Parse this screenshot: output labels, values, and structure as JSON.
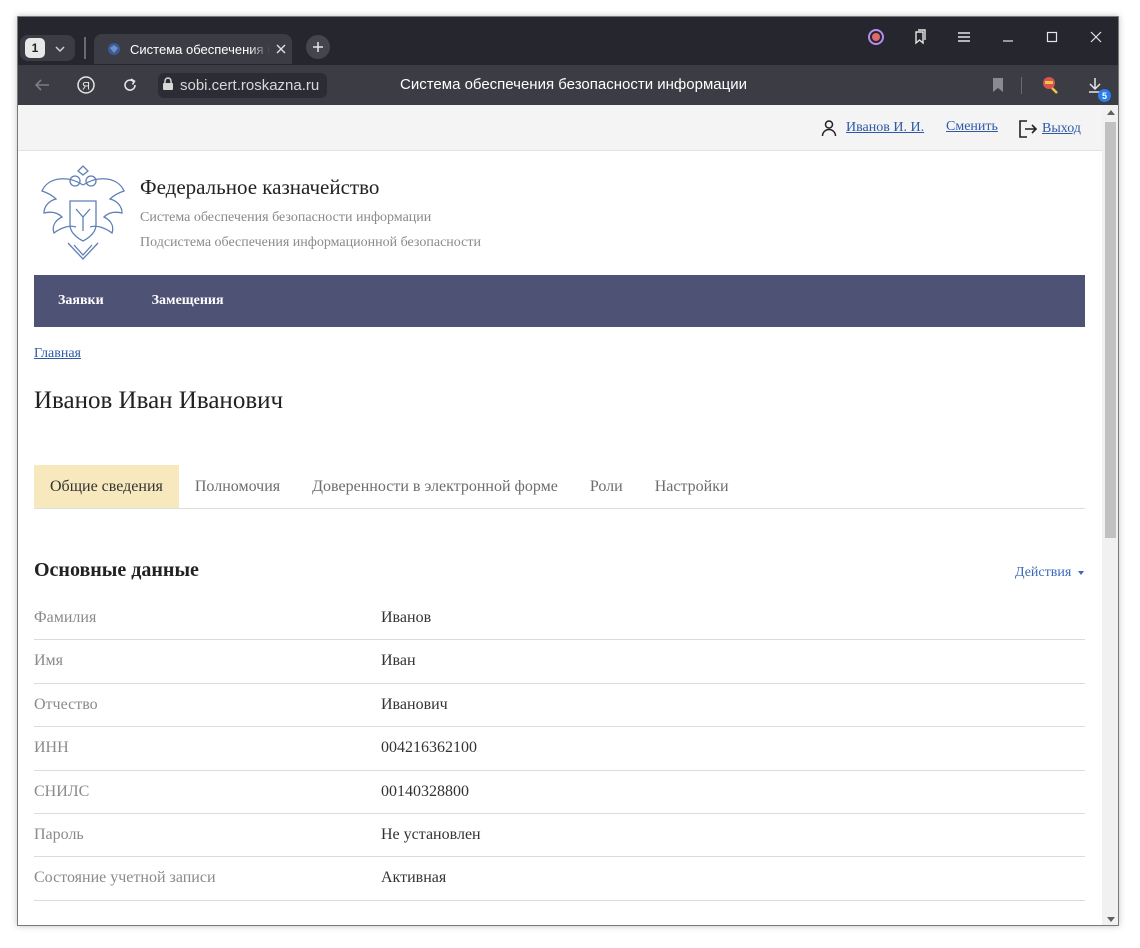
{
  "browser": {
    "tab_count": "1",
    "tab_title": "Система обеспечения безопасности информации",
    "url": "sobi.cert.roskazna.ru",
    "page_title": "Система обеспечения безопасности информации",
    "downloads_badge": "5"
  },
  "userbar": {
    "user_name": "Иванов И. И.",
    "change_label": "Сменить",
    "logout_label": "Выход"
  },
  "header": {
    "org_name": "Федеральное казначейство",
    "system_name": "Система обеспечения безопасности информации",
    "subsystem_name": "Подсистема обеспечения информационной безопасности"
  },
  "nav": {
    "items": [
      "Заявки",
      "Замещения"
    ]
  },
  "breadcrumb": "Главная",
  "person": {
    "full_name": "Иванов Иван Иванович"
  },
  "tabs": [
    {
      "label": "Общие сведения",
      "active": true
    },
    {
      "label": "Полномочия",
      "active": false
    },
    {
      "label": "Доверенности в электронной форме",
      "active": false
    },
    {
      "label": "Роли",
      "active": false
    },
    {
      "label": "Настройки",
      "active": false
    }
  ],
  "section": {
    "title": "Основные данные",
    "actions_label": "Действия"
  },
  "fields": [
    {
      "label": "Фамилия",
      "value": "Иванов"
    },
    {
      "label": "Имя",
      "value": "Иван"
    },
    {
      "label": "Отчество",
      "value": "Иванович"
    },
    {
      "label": "ИНН",
      "value": "004216362100"
    },
    {
      "label": "СНИЛС",
      "value": "00140328800"
    },
    {
      "label": "Пароль",
      "value": "Не установлен"
    },
    {
      "label": "Состояние учетной записи",
      "value": "Активная"
    }
  ],
  "colors": {
    "navbar": "#4e5274",
    "active_tab": "#f7e9bd",
    "link": "#2e58a8"
  }
}
